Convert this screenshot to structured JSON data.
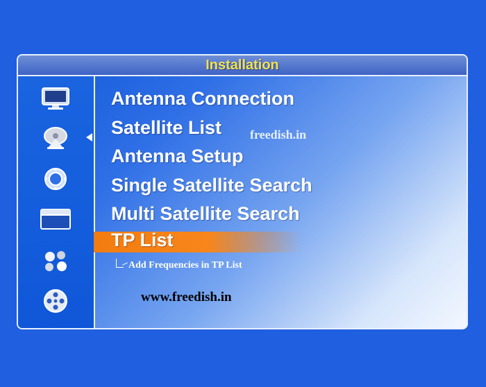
{
  "window": {
    "title": "Installation"
  },
  "sidebar": {
    "icons": [
      {
        "name": "tv-icon"
      },
      {
        "name": "satellite-dish-icon"
      },
      {
        "name": "settings-wheel-icon"
      },
      {
        "name": "folder-icon"
      },
      {
        "name": "media-icon"
      },
      {
        "name": "film-reel-icon"
      }
    ]
  },
  "menu": {
    "items": [
      {
        "label": "Antenna Connection"
      },
      {
        "label": "Satellite List"
      },
      {
        "label": "Antenna Setup"
      },
      {
        "label": "Single Satellite Search"
      },
      {
        "label": "Multi Satellite Search"
      },
      {
        "label": "TP List"
      }
    ],
    "selected": "TP List"
  },
  "watermark": "freedish.in",
  "annotation": "Add Frequencies in TP List",
  "site_url": "www.freedish.in",
  "colors": {
    "background": "#1f5fe0",
    "title": "#f3e24a",
    "highlight": "#f8861a"
  }
}
